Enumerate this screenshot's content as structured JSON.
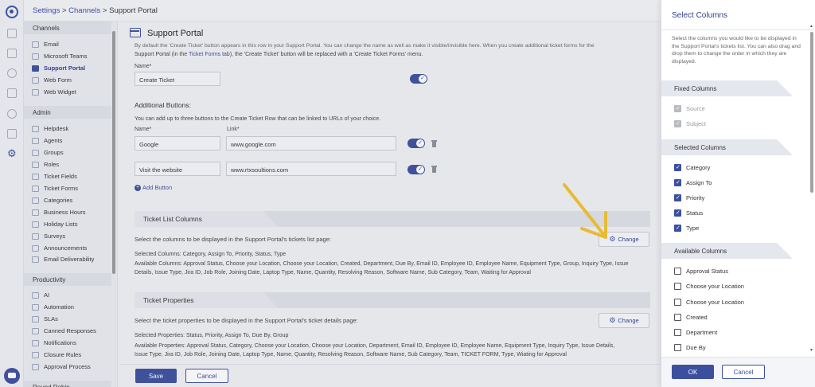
{
  "breadcrumb": {
    "settings": "Settings",
    "sep1": " > ",
    "channels": "Channels",
    "sep2": " > ",
    "current": "Support Portal"
  },
  "sidebar": {
    "sections": [
      {
        "title": "Channels",
        "items": [
          "Email",
          "Microsoft Teams",
          "Support Portal",
          "Web Form",
          "Web Widget"
        ]
      },
      {
        "title": "Admin",
        "items": [
          "Helpdesk",
          "Agents",
          "Groups",
          "Roles",
          "Ticket Fields",
          "Ticket Forms",
          "Categories",
          "Business Hours",
          "Holiday Lists",
          "Surveys",
          "Announcements",
          "Email Deliverability"
        ]
      },
      {
        "title": "Productivity",
        "items": [
          "AI",
          "Automation",
          "SLAs",
          "Canned Responses",
          "Notifications",
          "Closure Rules",
          "Approval Process"
        ]
      },
      {
        "title": "Round Robin"
      }
    ],
    "active": "Support Portal"
  },
  "page": {
    "title": "Support Portal",
    "intro_line1": "By default the 'Create Ticket' button appears in this row in your Support Portal. You can change the name as well as make it visible/invisible here. When you create additional ticket forms for the",
    "intro_line2a": "Support Portal (in the ",
    "intro_link": "Ticket Forms tab",
    "intro_line2b": "), the 'Create Ticket' button will be replaced with a 'Create Ticket Forms' menu.",
    "name_label": "Name*",
    "name_value": "Create Ticket",
    "additional_title": "Additional Buttons:",
    "additional_desc": "You can add up to three buttons to the Create Ticket Row that can be linked to URLs of your choice.",
    "col_name": "Name*",
    "col_link": "Link*",
    "buttons": [
      {
        "name": "Google",
        "link": "www.google.com"
      },
      {
        "name": "Visit the website",
        "link": "www.rtxsoultions.com"
      }
    ],
    "add_button": "Add Button",
    "ticket_list": {
      "title": "Ticket List Columns",
      "desc": "Select the columns to be displayed in the Support Portal's tickets list page:",
      "change": "Change",
      "selected_label": "Selected Columns:",
      "selected_value": "Category, Assign To, Priority, Status, Type",
      "available_label": "Available Columns:",
      "available_line1": "Approval Status, Choose your Location, Choose your Location, Created, Department, Due By, Email ID, Employee ID, Employee Name, Equipment Type, Group, Inquiry Type, Issue",
      "available_line2": "Details, Issue Type, Jira ID, Job Role, Joining Date, Laptop Type, Name, Quantity, Resolving Reason, Software Name, Sub Category, Team, Waiting for Approval"
    },
    "ticket_props": {
      "title": "Ticket Properties",
      "desc": "Select the ticket properties to be displayed in the Support Portal's ticket details page:",
      "change": "Change",
      "selected_label": "Selected Properties:",
      "selected_value": "Status, Priority, Assign To, Due By, Group",
      "available_label": "Available Properties:",
      "available_line1": "Approval Status, Category, Choose your Location, Choose your Location, Department, Email ID, Employee ID, Employee Name, Equipment Type, Inquiry Type, Issue Details,",
      "available_line2": "Issue Type, Jira ID, Job Role, Joining Date, Laptop Type, Name, Quantity, Resolving Reason, Software Name, Sub Category, Team, TICKET FORM, Type, Wiating for Approval"
    },
    "save": "Save",
    "cancel": "Cancel"
  },
  "panel": {
    "title": "Select Columns",
    "desc": "Select the columns you would like to be displayed in the Support Portal's tickets list. You can also drag and drop them to change the order in which they are displayed.",
    "fixed_title": "Fixed Columns",
    "fixed": [
      "Source",
      "Subject"
    ],
    "selected_title": "Selected Columns",
    "selected": [
      "Category",
      "Assign To",
      "Priority",
      "Status",
      "Type"
    ],
    "available_title": "Available Columns",
    "available": [
      "Approval Status",
      "Choose your Location",
      "Choose your Location",
      "Created",
      "Department",
      "Due By"
    ],
    "ok": "OK",
    "cancel": "Cancel"
  },
  "colors": {
    "accent": "#3c4f9f",
    "arrow": "#f2c22e"
  },
  "icons": {
    "gear": "⚙",
    "plus": "+"
  }
}
